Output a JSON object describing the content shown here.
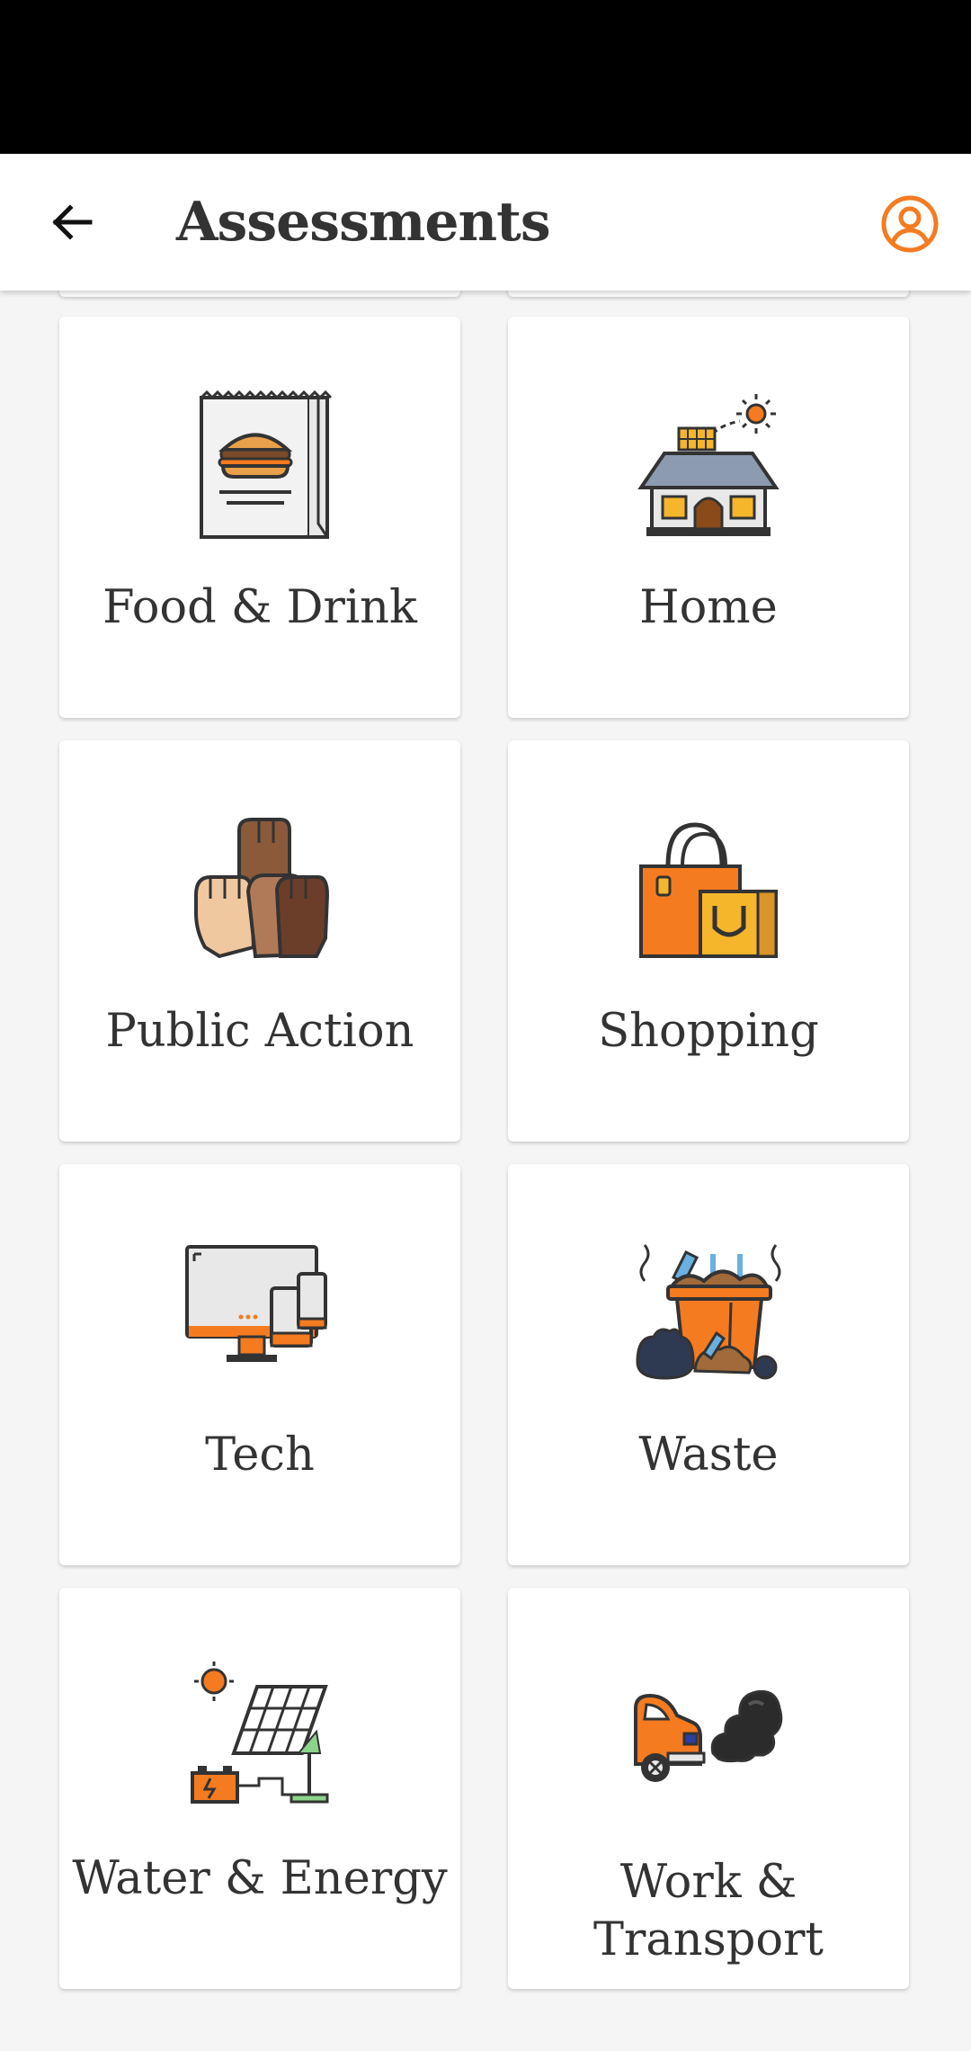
{
  "app_bar": {
    "title": "Assessments",
    "back_icon": "arrow-left-icon",
    "profile_icon": "user-circle-icon",
    "accent_color": "#F47B20"
  },
  "categories": [
    {
      "label": "Food & Drink",
      "icon": "food-bag-burger-icon"
    },
    {
      "label": "Home",
      "icon": "solar-house-icon"
    },
    {
      "label": "Public Action",
      "icon": "raised-fists-icon"
    },
    {
      "label": "Shopping",
      "icon": "shopping-bags-icon"
    },
    {
      "label": "Tech",
      "icon": "devices-icon"
    },
    {
      "label": "Waste",
      "icon": "garbage-bin-icon"
    },
    {
      "label": "Water & Energy",
      "icon": "solar-panel-battery-icon"
    },
    {
      "label": "Work &\nTransport",
      "label_line1": "Work &",
      "label_line2": "Transport",
      "icon": "car-exhaust-icon"
    }
  ]
}
